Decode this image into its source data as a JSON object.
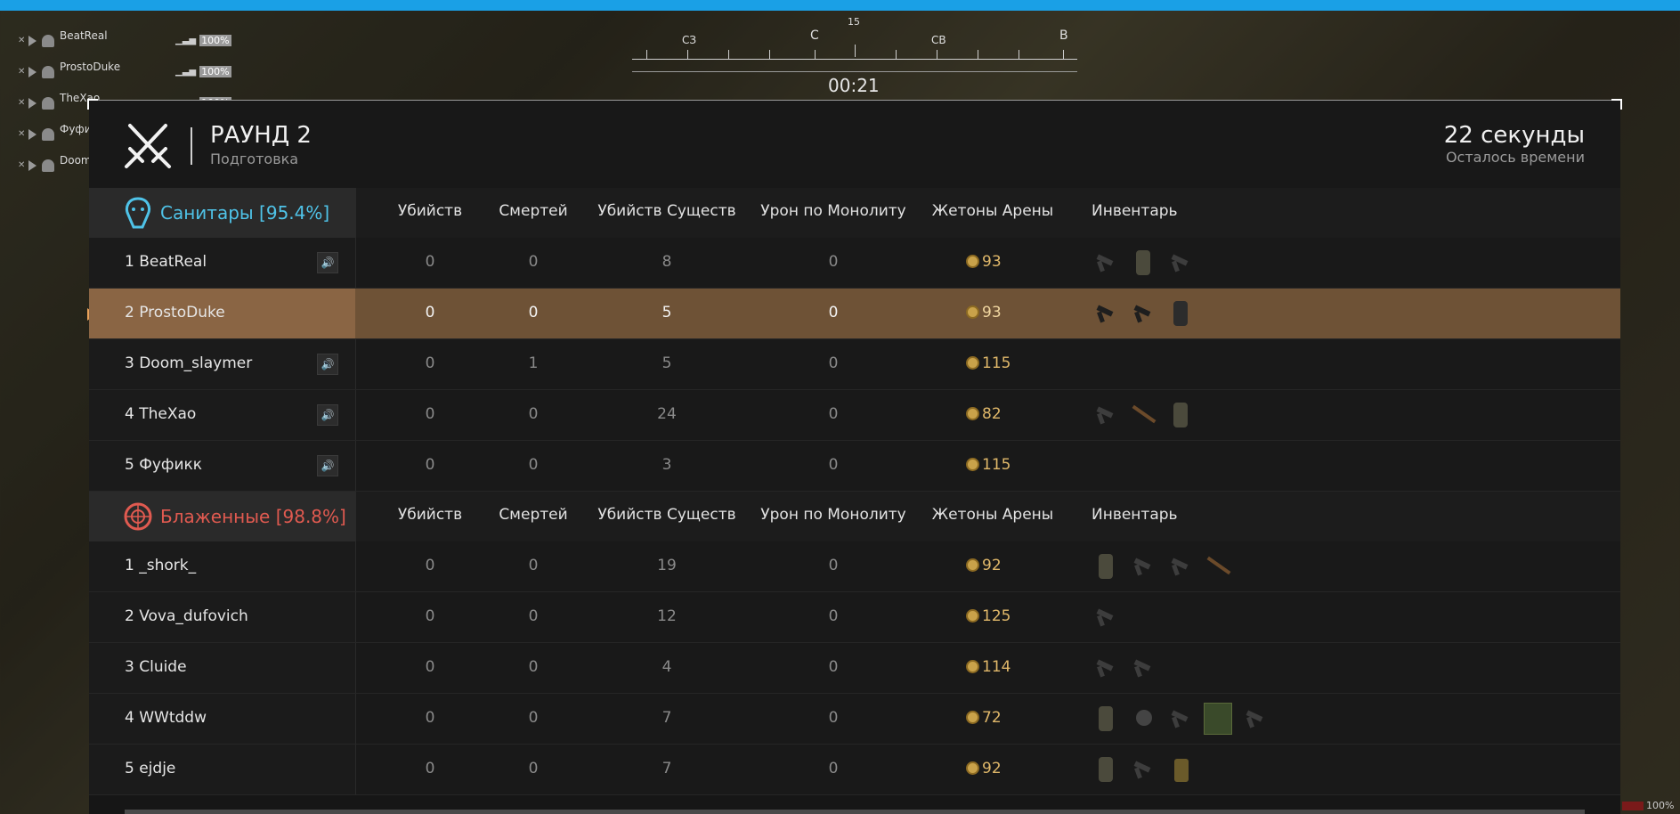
{
  "hud": {
    "squad": [
      {
        "name": "BeatReal",
        "pct": "100%"
      },
      {
        "name": "ProstoDuke",
        "pct": "100%"
      },
      {
        "name": "TheXao",
        "pct": "100%"
      },
      {
        "name": "Фуфи",
        "pct": ""
      },
      {
        "name": "Doom",
        "pct": ""
      }
    ],
    "compass": {
      "labels": [
        "СЗ",
        "С",
        "СВ",
        "В"
      ],
      "heading": "15"
    },
    "timer": "00:21",
    "bottom_pct": "100%"
  },
  "header": {
    "round_title": "РАУНД 2",
    "round_sub": "Подготовка",
    "time_left": "22 секунды",
    "time_sub": "Осталось времени"
  },
  "columns": [
    "Убийств",
    "Смертей",
    "Убийств Существ",
    "Урон по Монолиту",
    "Жетоны Арены",
    "Инвентарь"
  ],
  "teams": [
    {
      "name": "Санитары [95.4%]",
      "color": "#4fc3e8",
      "players": [
        {
          "name": "1 BeatReal",
          "kills": "0",
          "deaths": "0",
          "creature_kills": "8",
          "monolith_dmg": "0",
          "tokens": "93",
          "voice": true,
          "inventory": [
            "gun",
            "armor",
            "gun"
          ]
        },
        {
          "name": "2 ProstoDuke",
          "kills": "0",
          "deaths": "0",
          "creature_kills": "5",
          "monolith_dmg": "0",
          "tokens": "93",
          "voice": false,
          "highlight": true,
          "inventory": [
            "gun",
            "gun",
            "armor"
          ]
        },
        {
          "name": "3 Doom_slaymer",
          "kills": "0",
          "deaths": "1",
          "creature_kills": "5",
          "monolith_dmg": "0",
          "tokens": "115",
          "voice": true,
          "inventory": []
        },
        {
          "name": "4 TheXao",
          "kills": "0",
          "deaths": "0",
          "creature_kills": "24",
          "monolith_dmg": "0",
          "tokens": "82",
          "voice": true,
          "inventory": [
            "gun",
            "rifle",
            "armor"
          ]
        },
        {
          "name": "5 Фуфикк",
          "kills": "0",
          "deaths": "0",
          "creature_kills": "3",
          "monolith_dmg": "0",
          "tokens": "115",
          "voice": true,
          "inventory": []
        }
      ]
    },
    {
      "name": "Блаженные [98.8%]",
      "color": "#e05a50",
      "players": [
        {
          "name": "1 _shork_",
          "kills": "0",
          "deaths": "0",
          "creature_kills": "19",
          "monolith_dmg": "0",
          "tokens": "92",
          "inventory": [
            "armor",
            "gun",
            "gun",
            "rifle"
          ]
        },
        {
          "name": "2 Vova_dufovich",
          "kills": "0",
          "deaths": "0",
          "creature_kills": "12",
          "monolith_dmg": "0",
          "tokens": "125",
          "inventory": [
            "gun"
          ]
        },
        {
          "name": "3 Cluide",
          "kills": "0",
          "deaths": "0",
          "creature_kills": "4",
          "monolith_dmg": "0",
          "tokens": "114",
          "inventory": [
            "gun",
            "gun"
          ]
        },
        {
          "name": "4 WWtddw",
          "kills": "0",
          "deaths": "0",
          "creature_kills": "7",
          "monolith_dmg": "0",
          "tokens": "72",
          "inventory": [
            "armor",
            "grenade",
            "gun",
            "mask",
            "gun"
          ]
        },
        {
          "name": "5 ejdje",
          "kills": "0",
          "deaths": "0",
          "creature_kills": "7",
          "monolith_dmg": "0",
          "tokens": "92",
          "inventory": [
            "armor",
            "gun",
            "bag"
          ]
        }
      ]
    }
  ]
}
